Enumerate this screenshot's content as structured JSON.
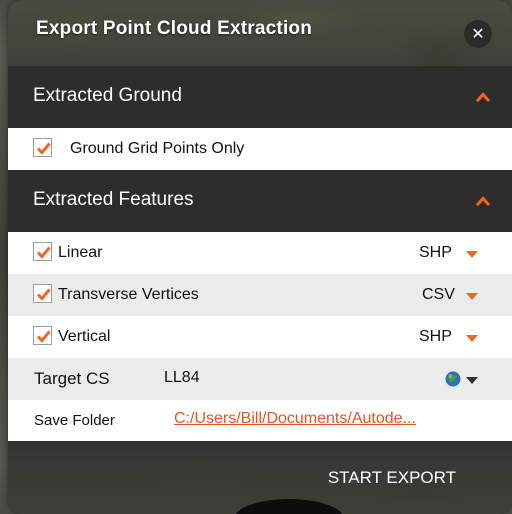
{
  "dialog": {
    "title": "Export Point Cloud Extraction",
    "close_icon": "close-icon"
  },
  "ground_section": {
    "header": "Extracted Ground",
    "expanded": true,
    "ground_grid_points_only": {
      "label": "Ground Grid Points Only",
      "checked": true
    }
  },
  "features_section": {
    "header": "Extracted Features",
    "expanded": true,
    "items": [
      {
        "label": "Linear",
        "checked": true,
        "format": "SHP"
      },
      {
        "label": "Transverse Vertices",
        "checked": true,
        "format": "CSV"
      },
      {
        "label": "Vertical",
        "checked": true,
        "format": "SHP"
      }
    ]
  },
  "target_cs": {
    "label": "Target CS",
    "value": "LL84",
    "icon": "globe-icon"
  },
  "save_folder": {
    "label": "Save Folder",
    "path": "C:/Users/Bill/Documents/Autode..."
  },
  "footer": {
    "start_export": "START EXPORT"
  },
  "colors": {
    "accent": "#f26522",
    "header_bg": "#2d2d2d",
    "link": "#e8551f"
  }
}
